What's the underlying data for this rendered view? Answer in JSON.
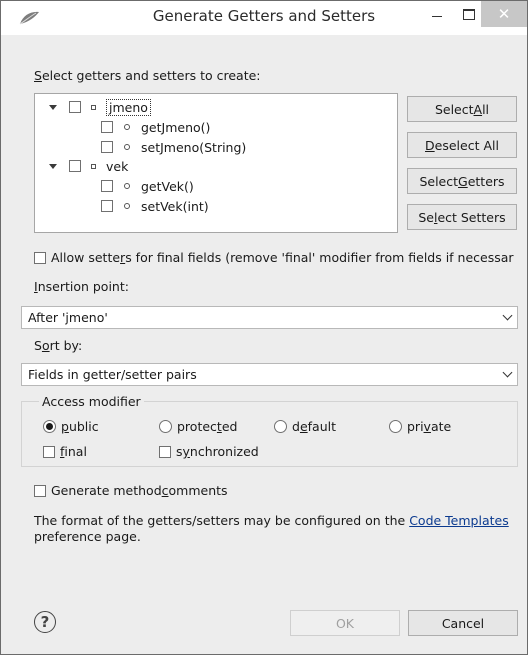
{
  "window": {
    "title": "Generate Getters and Setters",
    "minimize_icon": "minimize-icon",
    "maximize_icon": "maximize-icon",
    "close_glyph": "✕"
  },
  "select_label": {
    "mnemonic": "S",
    "rest": "elect getters and setters to create:"
  },
  "tree": {
    "fields": [
      {
        "name": "jmeno",
        "methods": [
          "getJmeno()",
          "setJmeno(String)"
        ]
      },
      {
        "name": "vek",
        "methods": [
          "getVek()",
          "setVek(int)"
        ]
      }
    ]
  },
  "side_buttons": {
    "select_all": {
      "pre": "Select ",
      "mn": "A",
      "post": "ll"
    },
    "deselect_all": {
      "pre": "",
      "mn": "D",
      "post": "eselect All"
    },
    "select_getters": {
      "pre": "Select ",
      "mn": "G",
      "post": "etters"
    },
    "select_setters": {
      "pre": "Se",
      "mn": "l",
      "post": "ect Setters"
    }
  },
  "allow_setters": {
    "pre": "Allow sette",
    "mn": "r",
    "post": "s for final fields (remove 'final' modifier from fields if necessar"
  },
  "insertion": {
    "label_mn": "I",
    "label_rest": "nsertion point:",
    "value": "After 'jmeno'"
  },
  "sort": {
    "label_pre": "S",
    "label_mn": "o",
    "label_rest": "rt by:",
    "value": "Fields in getter/setter pairs"
  },
  "access": {
    "legend": "Access modifier",
    "public": {
      "pre": "",
      "mn": "p",
      "post": "ublic"
    },
    "protected": {
      "pre": "protec",
      "mn": "t",
      "post": "ed"
    },
    "default": {
      "pre": "d",
      "mn": "e",
      "post": "fault"
    },
    "private": {
      "pre": "pri",
      "mn": "v",
      "post": "ate"
    },
    "final": {
      "pre": "",
      "mn": "f",
      "post": "inal"
    },
    "synchronized": {
      "pre": "s",
      "mn": "y",
      "post": "nchronized"
    },
    "selected": "public"
  },
  "gen_comments": {
    "pre": "Generate method ",
    "mn": "c",
    "post": "omments"
  },
  "info": {
    "text": "The format of the getters/setters may be configured on the ",
    "link": "Code Templates",
    "tail": "preference page."
  },
  "footer": {
    "help_glyph": "?",
    "ok": "OK",
    "cancel": "Cancel"
  }
}
